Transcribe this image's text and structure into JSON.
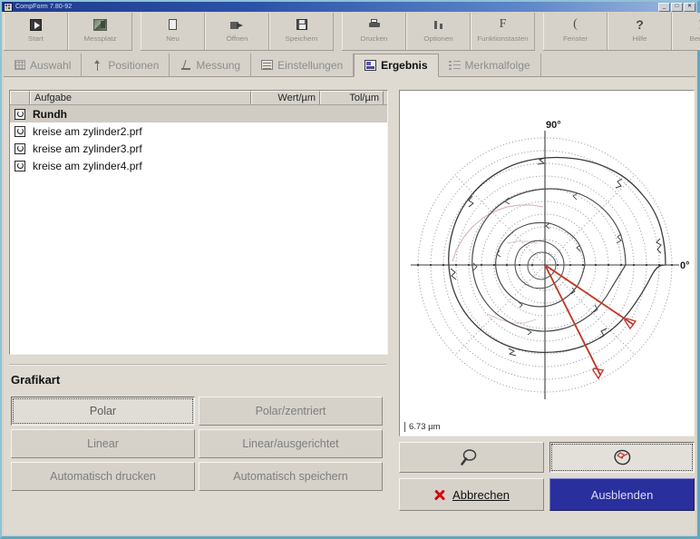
{
  "window": {
    "title": "CompForm 7.80-92",
    "controls": [
      {
        "name": "minimize",
        "glyph": "_"
      },
      {
        "name": "maximize",
        "glyph": "□"
      },
      {
        "name": "close",
        "glyph": "✕"
      }
    ]
  },
  "toolbar": {
    "groups": [
      {
        "buttons": [
          {
            "label": "Start",
            "icon": "start-play-icon",
            "icon_class": "ico-start"
          },
          {
            "label": "Messplatz",
            "icon": "measuring-station-icon",
            "icon_class": "ico-mess"
          }
        ]
      },
      {
        "buttons": [
          {
            "label": "Neu",
            "icon": "new-document-icon",
            "icon_class": "ico-doc"
          },
          {
            "label": "Öffnen",
            "icon": "open-folder-icon",
            "icon_class": "ico-open"
          },
          {
            "label": "Speichern",
            "icon": "save-disk-icon",
            "icon_class": "ico-save"
          }
        ]
      },
      {
        "buttons": [
          {
            "label": "Drucken",
            "icon": "printer-icon",
            "icon_class": "ico-print"
          },
          {
            "label": "Optionen",
            "icon": "options-sliders-icon",
            "icon_class": "ico-opt"
          },
          {
            "label": "Funktionstasten",
            "icon": "function-key-icon",
            "icon_class": "ico-fk",
            "glyph": "F"
          }
        ]
      },
      {
        "buttons": [
          {
            "label": "Fenster",
            "icon": "window-brace-icon",
            "icon_class": "ico-win",
            "glyph": "("
          },
          {
            "label": "Hilfe",
            "icon": "question-mark-icon",
            "icon_class": "ico-help",
            "glyph": "?"
          },
          {
            "label": "Beenden",
            "icon": "exit-cross-icon",
            "icon_class": "ico-exit"
          }
        ]
      }
    ]
  },
  "tabs": [
    {
      "label": "Auswahl",
      "icon": "selection-grid-icon",
      "icon_class": "ti-grid",
      "active": false
    },
    {
      "label": "Positionen",
      "icon": "position-arrow-icon",
      "icon_class": "ti-arrow",
      "active": false
    },
    {
      "label": "Messung",
      "icon": "measurement-icon",
      "icon_class": "ti-mess",
      "active": false
    },
    {
      "label": "Einstellungen",
      "icon": "settings-list-icon",
      "icon_class": "ti-set",
      "active": false
    },
    {
      "label": "Ergebnis",
      "icon": "result-chart-icon",
      "icon_class": "ti-result",
      "active": true
    },
    {
      "label": "Merkmalfolge",
      "icon": "feature-sequence-icon",
      "icon_class": "ti-seq",
      "active": false
    }
  ],
  "task_list": {
    "columns": [
      {
        "key": "icon",
        "label": ""
      },
      {
        "key": "task",
        "label": "Aufgabe"
      },
      {
        "key": "value",
        "label": "Wert/µm"
      },
      {
        "key": "tol",
        "label": "Tol/µm"
      }
    ],
    "rows": [
      {
        "icon": "roundness-icon",
        "task": "Rundh",
        "value": "",
        "tol": "",
        "selected": true
      },
      {
        "icon": "roundness-icon",
        "task": "kreise am zylinder2.prf",
        "value": "",
        "tol": "",
        "selected": false
      },
      {
        "icon": "roundness-icon",
        "task": "kreise am zylinder3.prf",
        "value": "",
        "tol": "",
        "selected": false
      },
      {
        "icon": "roundness-icon",
        "task": "kreise am zylinder4.prf",
        "value": "",
        "tol": "",
        "selected": false
      }
    ]
  },
  "grafikart": {
    "title": "Grafikart",
    "buttons": [
      {
        "label": "Polar",
        "pressed": true,
        "focused": true
      },
      {
        "label": "Polar/zentriert",
        "pressed": false,
        "focused": false
      },
      {
        "label": "Linear",
        "pressed": false,
        "focused": false
      },
      {
        "label": "Linear/ausgerichtet",
        "pressed": false,
        "focused": false
      },
      {
        "label": "Automatisch drucken",
        "pressed": false,
        "focused": false
      },
      {
        "label": "Automatisch speichern",
        "pressed": false,
        "focused": false
      }
    ]
  },
  "chart_panel": {
    "scale_label": "6.73 µm",
    "icon_buttons": [
      {
        "icon": "magnifier-zoom-icon",
        "pressed": false,
        "focused": false
      },
      {
        "icon": "profile-shape-icon",
        "pressed": true,
        "focused": true
      }
    ]
  },
  "actions": {
    "cancel_label": "Abbrechen",
    "cancel_icon": "red-x-icon",
    "hide_label": "Ausblenden"
  },
  "colors": {
    "window_bg": "#d6d2ca",
    "desktop": "#6ab0c8",
    "titlebar_start": "#1f3a8c",
    "accent_blue": "#2a2f9e",
    "cancel_red": "#d10d0d",
    "profile_trace": "#3a3a3a",
    "grid_dotted": "#9a9aa6",
    "marker_red": "#c0392b"
  },
  "chart_data": {
    "type": "line",
    "coordinate_system": "polar",
    "title": "",
    "angle_labels": [
      "90°",
      "0°"
    ],
    "scale_annotation": "6.73 µm",
    "grid": {
      "rings": 10,
      "dotted": true,
      "spokes_deg": [
        0,
        45,
        90,
        135,
        180,
        225,
        270,
        315
      ]
    },
    "axis_lines": {
      "vertical_deg": 90,
      "horizontal_deg": 0
    },
    "series": [
      {
        "name": "roundness-profile-outer",
        "color": "#3a3a3a",
        "angles_deg": [
          0,
          10,
          20,
          30,
          40,
          50,
          60,
          70,
          80,
          90,
          100,
          110,
          120,
          130,
          140,
          150,
          160,
          170,
          180,
          190,
          200,
          210,
          220,
          230,
          240,
          250,
          260,
          270,
          280,
          290,
          300,
          310,
          320,
          330,
          340,
          350
        ],
        "radii": [
          0.95,
          0.96,
          0.94,
          0.92,
          0.9,
          0.88,
          0.87,
          0.86,
          0.85,
          0.84,
          0.85,
          0.86,
          0.88,
          0.9,
          0.92,
          0.94,
          0.95,
          0.96,
          0.97,
          0.96,
          0.95,
          0.94,
          0.92,
          0.9,
          0.89,
          0.88,
          0.88,
          0.89,
          0.9,
          0.91,
          0.92,
          0.93,
          0.94,
          0.95,
          0.96,
          0.96
        ]
      },
      {
        "name": "roundness-profile-middle",
        "color": "#4a4a4a",
        "angles_deg": [
          0,
          10,
          20,
          30,
          40,
          50,
          60,
          70,
          80,
          90,
          100,
          110,
          120,
          130,
          140,
          150,
          160,
          170,
          180,
          190,
          200,
          210,
          220,
          230,
          240,
          250,
          260,
          270,
          280,
          290,
          300,
          310,
          320,
          330,
          340,
          350
        ],
        "radii": [
          0.63,
          0.63,
          0.62,
          0.61,
          0.6,
          0.59,
          0.58,
          0.58,
          0.57,
          0.57,
          0.58,
          0.59,
          0.6,
          0.61,
          0.62,
          0.63,
          0.64,
          0.64,
          0.65,
          0.64,
          0.63,
          0.62,
          0.61,
          0.6,
          0.6,
          0.59,
          0.59,
          0.6,
          0.61,
          0.61,
          0.62,
          0.62,
          0.63,
          0.63,
          0.63,
          0.63
        ]
      },
      {
        "name": "roundness-profile-inner",
        "color": "#4a4a4a",
        "angles_deg": [
          0,
          10,
          20,
          30,
          40,
          50,
          60,
          70,
          80,
          90,
          100,
          110,
          120,
          130,
          140,
          150,
          160,
          170,
          180,
          190,
          200,
          210,
          220,
          230,
          240,
          250,
          260,
          270,
          280,
          290,
          300,
          310,
          320,
          330,
          340,
          350
        ],
        "radii": [
          0.3,
          0.31,
          0.3,
          0.29,
          0.28,
          0.28,
          0.27,
          0.27,
          0.26,
          0.26,
          0.27,
          0.28,
          0.29,
          0.3,
          0.31,
          0.32,
          0.33,
          0.33,
          0.33,
          0.32,
          0.31,
          0.3,
          0.29,
          0.29,
          0.28,
          0.28,
          0.29,
          0.29,
          0.3,
          0.3,
          0.3,
          0.3,
          0.3,
          0.3,
          0.3,
          0.3
        ]
      },
      {
        "name": "roundness-profile-core",
        "color": "#555555",
        "angles_deg": [
          0,
          15,
          30,
          45,
          60,
          75,
          90,
          105,
          120,
          135,
          150,
          165,
          180,
          195,
          210,
          225,
          240,
          255,
          270,
          285,
          300,
          315,
          330,
          345
        ],
        "radii": [
          0.14,
          0.15,
          0.14,
          0.13,
          0.12,
          0.12,
          0.13,
          0.14,
          0.15,
          0.16,
          0.15,
          0.14,
          0.14,
          0.13,
          0.12,
          0.12,
          0.13,
          0.13,
          0.14,
          0.14,
          0.13,
          0.13,
          0.14,
          0.14
        ]
      }
    ],
    "markers": [
      {
        "name": "radius-marker-1",
        "angle_deg": -20,
        "radius": 0.82,
        "color": "#c0392b"
      },
      {
        "name": "radius-marker-2",
        "angle_deg": -60,
        "radius": 0.9,
        "color": "#c0392b"
      }
    ]
  }
}
